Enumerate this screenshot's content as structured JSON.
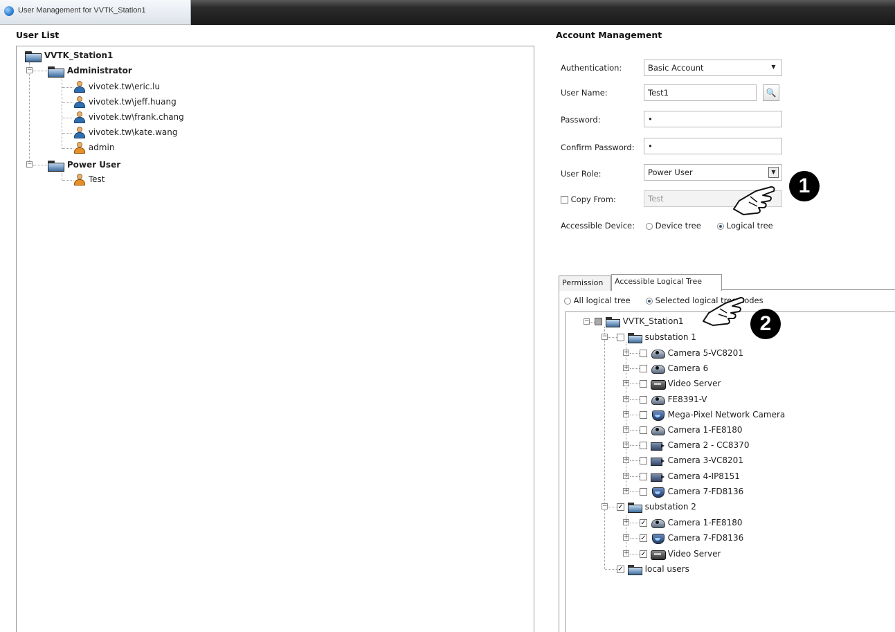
{
  "window": {
    "title": "User Management for VVTK_Station1"
  },
  "user_list": {
    "title": "User List",
    "root": "VVTK_Station1",
    "groups": [
      {
        "name": "Administrator",
        "users": [
          "vivotek.tw\\eric.lu",
          "vivotek.tw\\jeff.huang",
          "vivotek.tw\\frank.chang",
          "vivotek.tw\\kate.wang",
          "admin"
        ]
      },
      {
        "name": "Power User",
        "users": [
          "Test"
        ]
      }
    ]
  },
  "account": {
    "title": "Account Management",
    "authentication_label": "Authentication:",
    "authentication_value": "Basic Account",
    "username_label": "User Name:",
    "username_value": "Test1",
    "password_label": "Password:",
    "password_value": "•",
    "confirm_label": "Confirm Password:",
    "confirm_value": "•",
    "role_label": "User Role:",
    "role_value": "Power User",
    "copy_from_label": "Copy From:",
    "copy_from_value": "Test",
    "accessible_label": "Accessible Device:",
    "device_tree_label": "Device tree",
    "logical_tree_label": "Logical tree"
  },
  "tabs": {
    "permission": "Permission",
    "accessible": "Accessible Logical Tree"
  },
  "logical": {
    "all_label": "All logical tree",
    "selected_label": "Selected logical tree nodes",
    "root": "VVTK_Station1",
    "substation1": {
      "name": "substation 1",
      "devices": [
        "Camera 5-VC8201",
        "Camera 6",
        "Video Server",
        "FE8391-V",
        "Mega-Pixel Network Camera",
        "Camera 1-FE8180",
        "Camera 2 - CC8370",
        "Camera 3-VC8201",
        "Camera 4-IP8151",
        "Camera 7-FD8136"
      ]
    },
    "substation2": {
      "name": "substation 2",
      "devices": [
        "Camera 1-FE8180",
        "Camera 7-FD8136",
        "Video Server"
      ]
    },
    "local_users": "local users"
  },
  "callouts": {
    "one": "1",
    "two": "2"
  }
}
